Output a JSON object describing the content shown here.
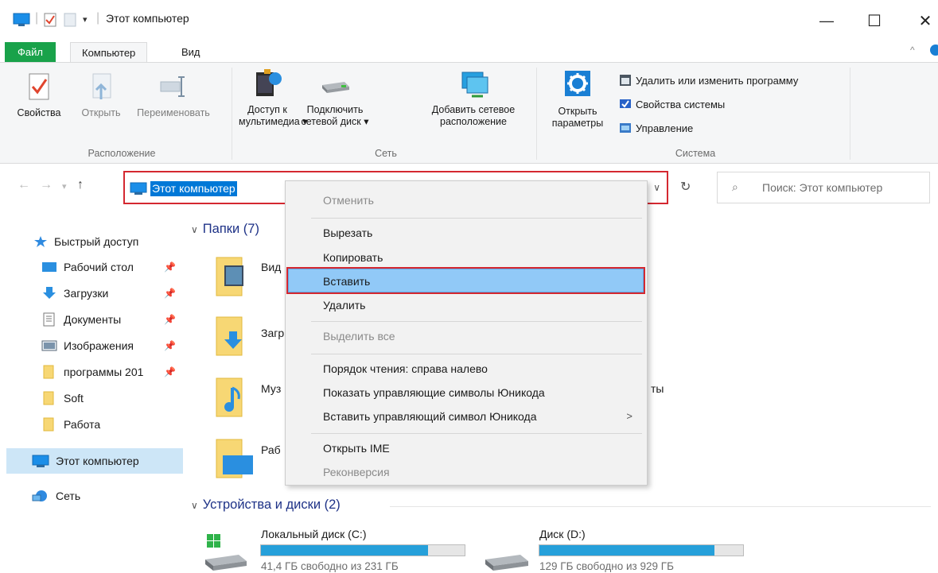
{
  "window": {
    "title": "Этот компьютер",
    "minimize": "—",
    "maximize": "☐",
    "close": "✕"
  },
  "tabs": {
    "file": "Файл",
    "computer": "Компьютер",
    "view": "Вид"
  },
  "ribbon": {
    "location_group": {
      "label": "Расположение",
      "properties": "Свойства",
      "open": "Открыть",
      "rename": "Переименовать"
    },
    "network_group": {
      "label": "Сеть",
      "media_line1": "Доступ к",
      "media_line2": "мультимедиа ▾",
      "map_line1": "Подключить",
      "map_line2": "сетевой диск ▾",
      "add_line1": "Добавить сетевое",
      "add_line2": "расположение"
    },
    "system_group": {
      "label": "Система",
      "settings_line1": "Открыть",
      "settings_line2": "параметры",
      "uninstall": "Удалить или изменить программу",
      "sys_props": "Свойства системы",
      "manage": "Управление"
    }
  },
  "address": {
    "path": "Этот компьютер",
    "search_placeholder": "Поиск: Этот компьютер"
  },
  "nav": {
    "quick_access": "Быстрый доступ",
    "items": [
      {
        "label": "Рабочий стол",
        "pinned": true
      },
      {
        "label": "Загрузки",
        "pinned": true
      },
      {
        "label": "Документы",
        "pinned": true
      },
      {
        "label": "Изображения",
        "pinned": true
      },
      {
        "label": "программы 201",
        "pinned": true
      },
      {
        "label": "Soft",
        "pinned": false
      },
      {
        "label": "Работа",
        "pinned": false
      }
    ],
    "this_pc": "Этот компьютер",
    "network": "Сеть"
  },
  "content": {
    "folders_header": "Папки (7)",
    "folders": [
      {
        "label": "Вид"
      },
      {
        "label": "Загр"
      },
      {
        "label": "Муз"
      },
      {
        "label": "Раб"
      }
    ],
    "folder_tail_text": "ты",
    "drives_header": "Устройства и диски (2)",
    "drives": [
      {
        "name": "Локальный диск (C:)",
        "free": "41,4 ГБ свободно из 231 ГБ",
        "used_fraction": 0.82
      },
      {
        "name": "Диск (D:)",
        "free": "129 ГБ свободно из 929 ГБ",
        "used_fraction": 0.86
      }
    ]
  },
  "context_menu": {
    "undo": "Отменить",
    "cut": "Вырезать",
    "copy": "Копировать",
    "paste": "Вставить",
    "delete": "Удалить",
    "select_all": "Выделить все",
    "rtl": "Порядок чтения: справа налево",
    "show_unicode": "Показать управляющие символы Юникода",
    "insert_unicode": "Вставить управляющий символ Юникода",
    "open_ime": "Открыть IME",
    "reconversion": "Реконверсия"
  },
  "colors": {
    "accent": "#0078d7",
    "file_tab": "#19a24a",
    "highlight_border": "#d42830",
    "menu_hover": "#91c9f7"
  }
}
